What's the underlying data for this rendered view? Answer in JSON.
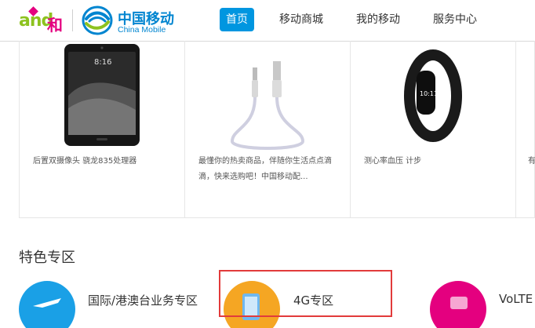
{
  "header": {
    "logo_and": "and",
    "logo_he": "和",
    "brand_cn": "中国移动",
    "brand_en": "China Mobile",
    "nav": [
      {
        "label": "首页",
        "active": true
      },
      {
        "label": "移动商城",
        "active": false
      },
      {
        "label": "我的移动",
        "active": false
      },
      {
        "label": "服务中心",
        "active": false
      }
    ]
  },
  "products": [
    {
      "desc": "后置双摄像头 骁龙835处理器"
    },
    {
      "desc": "最懂你的热卖商品，伴随你生活点点滴滴，快来选购吧！中国移动配..."
    },
    {
      "desc": "测心率血压 计步"
    },
    {
      "desc": "有"
    }
  ],
  "section": {
    "title": "特色专区",
    "features": [
      {
        "label": "国际/港澳台业务专区",
        "color": "#1aa0e6"
      },
      {
        "label": "4G专区",
        "color": "#f5a623"
      },
      {
        "label": "VoLTE",
        "color": "#e4007f"
      }
    ]
  },
  "colors": {
    "accent": "#0096e0",
    "highlight": "#e23b3b",
    "brand_blue": "#0085d0"
  }
}
